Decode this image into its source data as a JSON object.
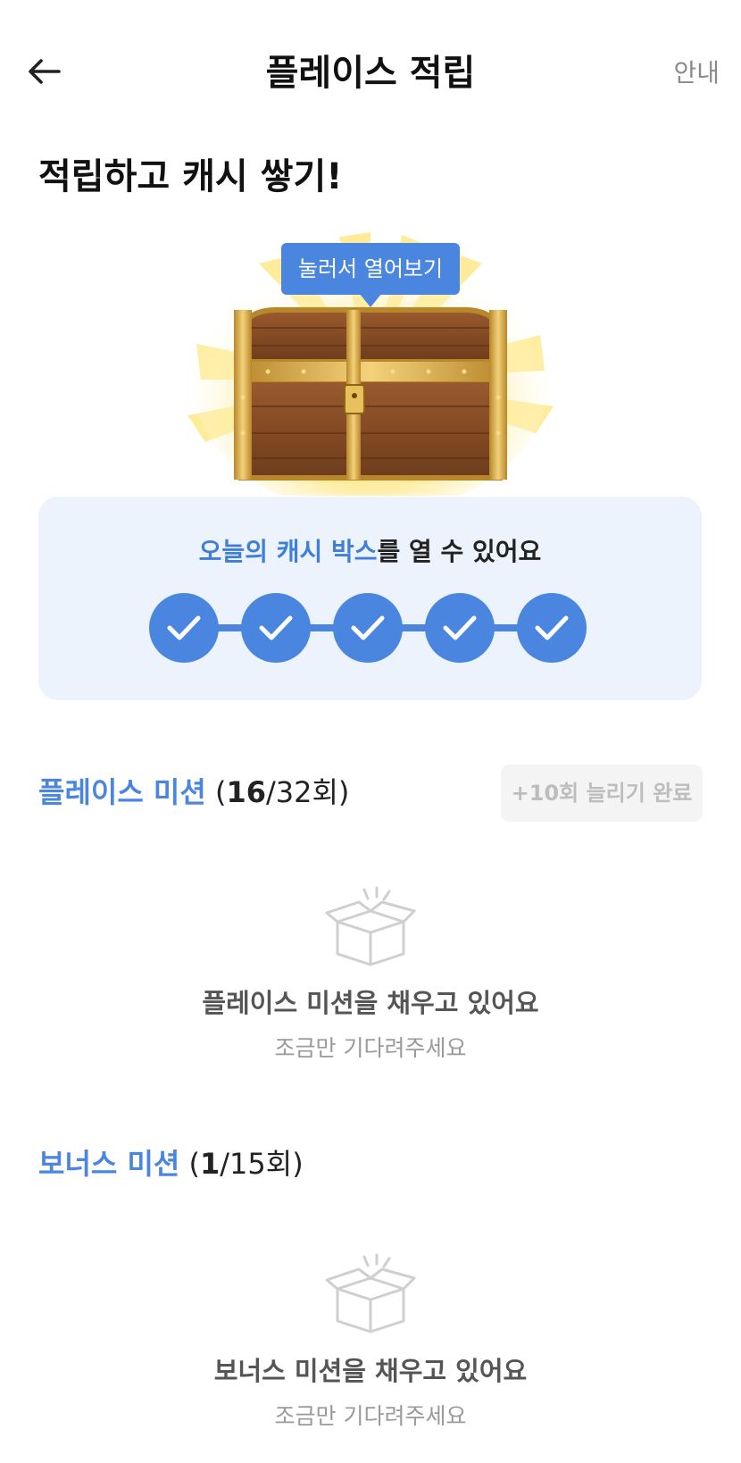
{
  "header": {
    "title": "플레이스 적립",
    "guide_label": "안내"
  },
  "headline": "적립하고 캐시 쌓기!",
  "chest": {
    "tooltip": "눌러서 열어보기"
  },
  "progress_card": {
    "text_highlight": "오늘의 캐시 박스",
    "text_rest": "를 열 수 있어요",
    "steps_total": 5,
    "steps_completed": 5,
    "accent_color": "#4a86e0"
  },
  "place_mission": {
    "title": "플레이스 미션",
    "count_open": " (",
    "count_done": "16",
    "count_rest": "/32회)",
    "extend_button": "+10회 늘리기 완료",
    "empty_title": "플레이스 미션을 채우고 있어요",
    "empty_sub": "조금만 기다려주세요"
  },
  "bonus_mission": {
    "title": "보너스 미션",
    "count_open": " (",
    "count_done": "1",
    "count_rest": "/15회)",
    "empty_title": "보너스 미션을 채우고 있어요",
    "empty_sub": "조금만 기다려주세요"
  },
  "icons": {
    "back": "arrow-left-icon",
    "chest": "treasure-chest-icon",
    "check": "check-icon",
    "empty_box": "open-box-icon"
  }
}
